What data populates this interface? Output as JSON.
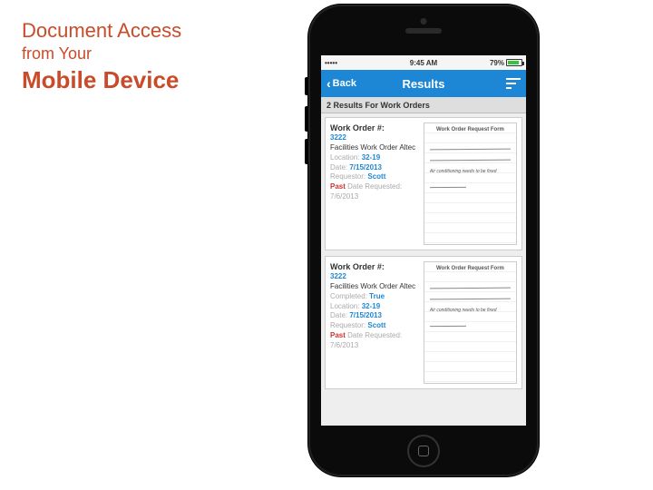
{
  "title": {
    "line1": "Document Access",
    "line2": "from Your",
    "line3": "Mobile Device"
  },
  "status": {
    "time": "9:45 AM",
    "battery": "79%"
  },
  "nav": {
    "back": "Back",
    "title": "Results"
  },
  "results_header": "2 Results For Work Orders",
  "labels": {
    "wo": "Work Order #:",
    "completed": "Completed:",
    "location": "Location:",
    "date": "Date:",
    "requestor": "Requestor:",
    "past": "Past",
    "datereq": "Date Requested:"
  },
  "cards": [
    {
      "wo": "3222",
      "desc": "Facilities Work Order Altec",
      "location": "32-19",
      "date": "7/15/2013",
      "requestor": "Scott",
      "datereq": "7/6/2013",
      "form_title": "Work Order Request Form",
      "note": "Air conditioning needs to be fixed"
    },
    {
      "wo": "3222",
      "desc": "Facilities Work Order Altec",
      "completed": "True",
      "location": "32-19",
      "date": "7/15/2013",
      "requestor": "Scott",
      "datereq": "7/6/2013",
      "form_title": "Work Order Request Form",
      "note": "Air conditioning needs to be fixed"
    }
  ]
}
